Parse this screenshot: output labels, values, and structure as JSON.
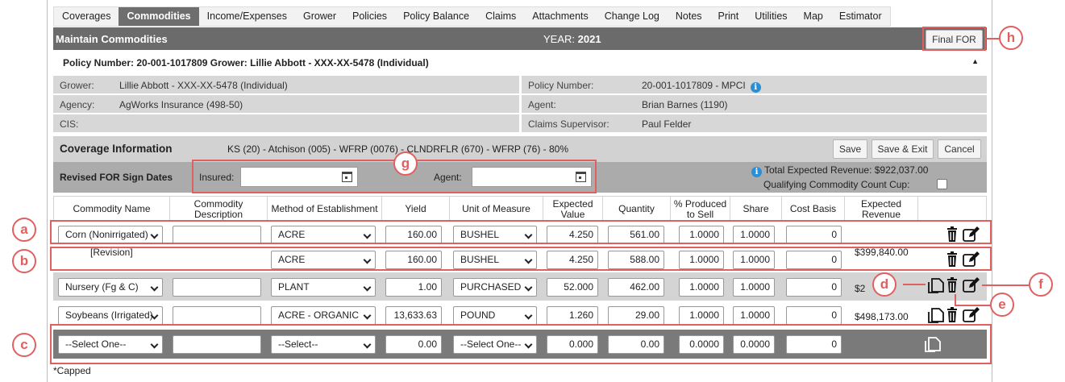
{
  "tabs": [
    "Coverages",
    "Commodities",
    "Income/Expenses",
    "Grower",
    "Policies",
    "Policy Balance",
    "Claims",
    "Attachments",
    "Change Log",
    "Notes",
    "Print",
    "Utilities",
    "Map",
    "Estimator"
  ],
  "active_tab": "Commodities",
  "header": {
    "title": "Maintain Commodities",
    "year_label": "YEAR:",
    "year": "2021",
    "final_for_label": "Final FOR"
  },
  "policy_line": "Policy Number: 20-001-1017809 Grower: Lillie Abbott - XXX-XX-5478 (Individual)",
  "info": {
    "grower_label": "Grower:",
    "grower": "Lillie Abbott - XXX-XX-5478 (Individual)",
    "agency_label": "Agency:",
    "agency": "AgWorks Insurance (498-50)",
    "cis_label": "CIS:",
    "cis": "",
    "policy_label": "Policy Number:",
    "policy": "20-001-1017809 - MPCI",
    "agent_label": "Agent:",
    "agent": "Brian Barnes (1190)",
    "claims_label": "Claims Supervisor:",
    "claims": "Paul Felder"
  },
  "coverage": {
    "title": "Coverage Information",
    "description": "KS (20) - Atchison (005) - WFRP (0076) - CLNDRFLR (670) - WFRP (76) - 80%",
    "save_label": "Save",
    "save_exit_label": "Save & Exit",
    "cancel_label": "Cancel"
  },
  "revised": {
    "label": "Revised FOR Sign Dates",
    "insured_label": "Insured:",
    "insured_value": "",
    "agent_label": "Agent:",
    "agent_value": "",
    "total_revenue": "Total Expected Revenue: $922,037.00",
    "qualifying_label": "Qualifying Commodity Count Cup:"
  },
  "columns": [
    "Commodity Name",
    "Commodity Description",
    "Method of Establishment",
    "Yield",
    "Unit of Measure",
    "Expected Value",
    "Quantity",
    "% Produced to Sell",
    "Share",
    "Cost Basis",
    "Expected Revenue",
    ""
  ],
  "rows": [
    {
      "commodity": "Corn (Nonirrigated)",
      "label": "",
      "description": "",
      "method": "ACRE",
      "yield": "160.00",
      "unit": "BUSHEL",
      "expected_value": "4.250",
      "quantity": "561.00",
      "pct": "1.0000",
      "share": "1.0000",
      "cost_basis": "0",
      "revenue": ""
    },
    {
      "commodity": "",
      "label": "[Revision]",
      "description": "",
      "method": "ACRE",
      "yield": "160.00",
      "unit": "BUSHEL",
      "expected_value": "4.250",
      "quantity": "588.00",
      "pct": "1.0000",
      "share": "1.0000",
      "cost_basis": "0",
      "revenue": "$399,840.00"
    },
    {
      "commodity": "Nursery (Fg & C)",
      "label": "",
      "description": "",
      "method": "PLANT",
      "yield": "1.00",
      "unit": "PURCHASED",
      "expected_value": "52.000",
      "quantity": "462.00",
      "pct": "1.0000",
      "share": "1.0000",
      "cost_basis": "0",
      "revenue": "$2"
    },
    {
      "commodity": "Soybeans (Irrigated)",
      "label": "",
      "description": "",
      "method": "ACRE - ORGANIC",
      "yield": "13,633.63",
      "unit": "POUND",
      "expected_value": "1.260",
      "quantity": "29.00",
      "pct": "1.0000",
      "share": "1.0000",
      "cost_basis": "0",
      "revenue": "$498,173.00"
    },
    {
      "commodity": "--Select One--",
      "label": "",
      "description": "",
      "method": "--Select--",
      "yield": "0.00",
      "unit": "--Select One--",
      "expected_value": "0.000",
      "quantity": "0.00",
      "pct": "0.0000",
      "share": "0.0000",
      "cost_basis": "0",
      "revenue": ""
    }
  ],
  "footnote": "*Capped",
  "callouts": [
    "a",
    "b",
    "c",
    "d",
    "e",
    "f",
    "g",
    "h"
  ],
  "colors": {
    "header_bg": "#6b6b6b",
    "callout": "#e06060",
    "info_icon": "#2b8fd6",
    "new_row_bg": "#7a7a7a"
  }
}
